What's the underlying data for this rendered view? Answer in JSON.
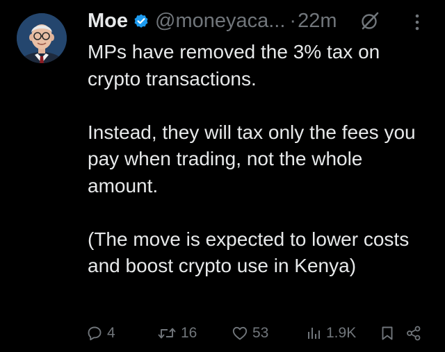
{
  "author": {
    "name": "Moe",
    "handle": "@moneyaca...",
    "separator": "·",
    "time": "22m",
    "avatar_icon": "avatar-portrait",
    "verified_color": "#1d9bf0"
  },
  "tweet": {
    "paragraphs": [
      "MPs have removed the 3% tax on crypto transactions.",
      "Instead, they will tax only the fees you pay when trading, not the whole amount.",
      "(The move is expected to lower costs and boost crypto use in Kenya)"
    ]
  },
  "actions": {
    "replies": "4",
    "reposts": "16",
    "likes": "53",
    "views": "1.9K"
  },
  "colors": {
    "background": "#000000",
    "text": "#e7e9ea",
    "secondary": "#71767b"
  }
}
